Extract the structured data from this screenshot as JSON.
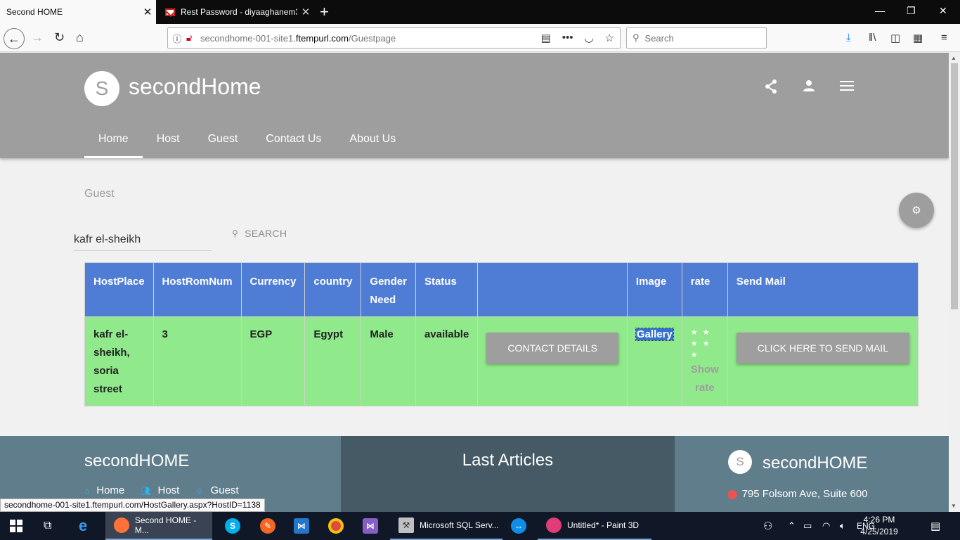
{
  "browser": {
    "tabs": [
      {
        "title": "Second HOME",
        "active": true
      },
      {
        "title": "Rest Password - diyaaghanem3",
        "active": false
      }
    ],
    "url_host": "secondhome-001-site1.",
    "url_domain": "ftempurl.com",
    "url_path": "/Guestpage",
    "search_placeholder": "Search",
    "status_url": "secondhome-001-site1.ftempurl.com/HostGallery.aspx?HostID=1138"
  },
  "site": {
    "logo_letter": "S",
    "logo_light": "second",
    "logo_bold": "Home",
    "menu": [
      {
        "label": "Home",
        "active": true
      },
      {
        "label": "Host",
        "active": false
      },
      {
        "label": "Guest",
        "active": false
      },
      {
        "label": "Contact Us",
        "active": false
      },
      {
        "label": "About Us",
        "active": false
      }
    ]
  },
  "main": {
    "page_label": "Guest",
    "search_value": "kafr el-sheikh",
    "search_button": "SEARCH",
    "table": {
      "headers": [
        "HostPlace",
        "HostRomNum",
        "Currency",
        "country",
        "Gender Need",
        "Status",
        "",
        "Image",
        "rate",
        "Send Mail"
      ],
      "row": {
        "host_place": "kafr el-sheikh, soria street",
        "host_rom_num": "3",
        "currency": "EGP",
        "country": "Egypt",
        "gender_need": "Male",
        "status": "available",
        "contact_button": "CONTACT DETAILS",
        "image_link": "Gallery",
        "rate_stars": "★ ★ ★ ★ ★",
        "show_rate": "Show rate",
        "send_mail_button": "CLICK HERE TO SEND MAIL"
      }
    }
  },
  "footer": {
    "left_title": "secondHOME",
    "links": [
      "Home",
      "Host",
      "Guest"
    ],
    "mid_title": "Last Articles",
    "right_logo_letter": "S",
    "right_logo_light": "second",
    "right_logo_bold": "HOME",
    "address": "795 Folsom Ave, Suite 600"
  },
  "taskbar": {
    "apps": [
      {
        "label": "Second HOME - M...",
        "active": true
      },
      {
        "label": "Microsoft SQL Serv...",
        "active": false
      },
      {
        "label": "Untitled* - Paint 3D",
        "active": false
      }
    ],
    "language": "ENG",
    "time": "4:26 PM",
    "date": "4/25/2019"
  },
  "colors": {
    "header_bg": "#9e9e9e",
    "table_header_bg": "#4f7cd4",
    "table_row_bg": "#90e98b",
    "footer_bg": "#607d8b",
    "footer_mid_bg": "#455a64"
  }
}
